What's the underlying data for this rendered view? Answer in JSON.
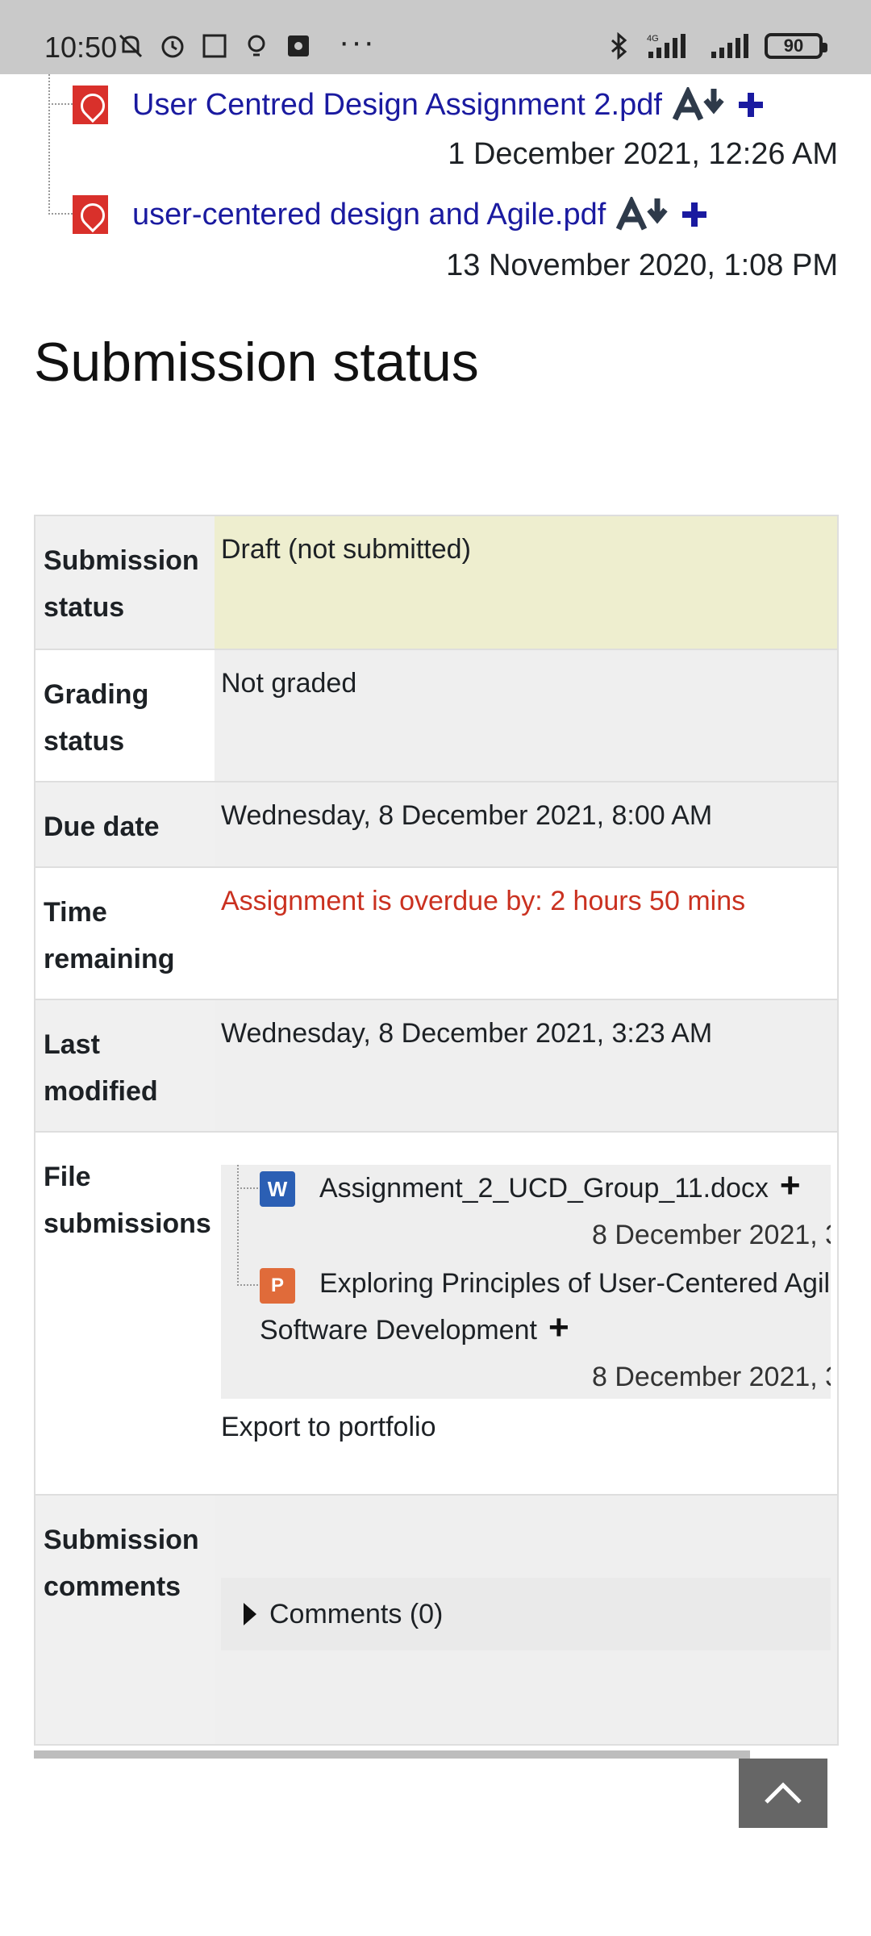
{
  "status_bar": {
    "time": "10:50",
    "battery": "90",
    "network": "4G",
    "left_icons": [
      "mute-icon",
      "alarm-icon",
      "sim-icon",
      "bulb-icon",
      "app-icon",
      "more-icon"
    ],
    "right_icons": [
      "bluetooth-icon",
      "signal-4g-icon",
      "signal-icon",
      "battery-icon"
    ]
  },
  "attachments": [
    {
      "name": "User Centred Design Assignment 2.pdf",
      "date": "1 December 2021, 12:26 AM"
    },
    {
      "name": "user-centered design and Agile.pdf",
      "date": "13 November 2020, 1:08 PM"
    }
  ],
  "section_title": "Submission status",
  "table": {
    "submission_status": {
      "label": "Submission status",
      "value": "Draft (not submitted)"
    },
    "grading_status": {
      "label": "Grading status",
      "value": "Not graded"
    },
    "due_date": {
      "label": "Due date",
      "value": "Wednesday, 8 December 2021, 8:00 AM"
    },
    "time_remaining": {
      "label": "Time remaining",
      "value": "Assignment is overdue by: 2 hours 50 mins"
    },
    "last_modified": {
      "label": "Last modified",
      "value": "Wednesday, 8 December 2021, 3:23 AM"
    },
    "file_submissions": {
      "label": "File submissions",
      "files": [
        {
          "name": "Assignment_2_UCD_Group_11.docx",
          "date": "8 December 2021, 3"
        },
        {
          "name_line1": "Exploring Principles of User-Centered Agil",
          "name_line2": "Software Development",
          "date": "8 December 2021, 3"
        }
      ],
      "export_link": "Export to portfolio"
    },
    "submission_comments": {
      "label": "Submission comments",
      "toggle": "Comments (0)"
    }
  },
  "colors": {
    "link": "#1a1aa0",
    "overdue": "#ca3120",
    "draft_bg": "#eeeecf"
  }
}
